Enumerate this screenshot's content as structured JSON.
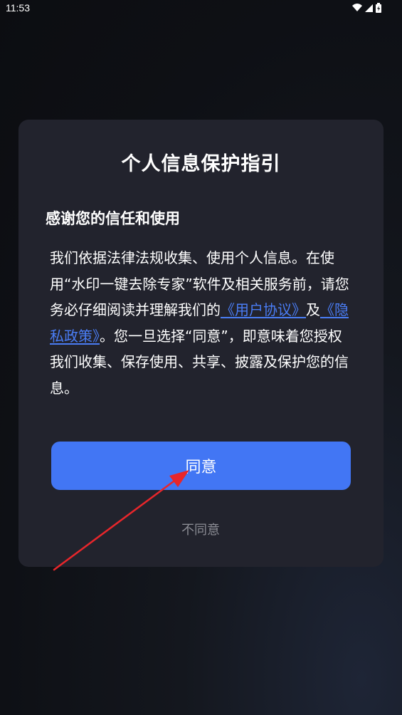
{
  "status_bar": {
    "time": "11:53",
    "icons": [
      "wifi-icon",
      "signal-icon",
      "battery-icon"
    ]
  },
  "dialog": {
    "title": "个人信息保护指引",
    "subtitle": "感谢您的信任和使用",
    "body": {
      "part1": "我们依据法律法规收集、使用个人信息。在使用“水印一键去除专家”软件及相关服务前，请您务必仔细阅读并理解我们的",
      "user_agreement_link": "《用户协议》",
      "conjunction": "及",
      "privacy_policy_link": "《隐私政策》",
      "part2": "。您一旦选择“同意”，即意味着您授权我们收集、保存使用、共享、披露及保护您的信息。"
    },
    "agree_label": "同意",
    "disagree_label": "不同意"
  },
  "colors": {
    "background": "#0e1015",
    "dialog_bg": "#22232d",
    "accent": "#4276f4",
    "link": "#4a7df5",
    "muted_text": "#8b8c94",
    "annotation_arrow": "#e8262b"
  }
}
